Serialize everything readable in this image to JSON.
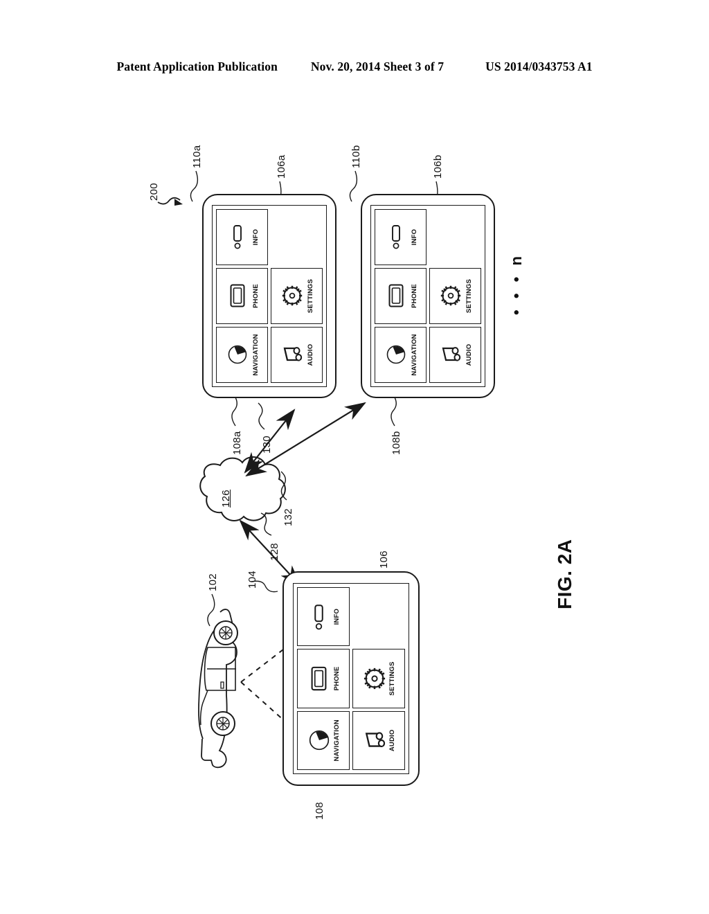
{
  "header": {
    "publication": "Patent Application Publication",
    "date_sheet": "Nov. 20, 2014  Sheet 3 of 7",
    "patent_number": "US 2014/0343753 A1"
  },
  "figure": {
    "label": "FIG. 2A",
    "system_ref": "200",
    "continuation": "• • •  n"
  },
  "tiles": {
    "navigation": "NAVIGATION",
    "phone": "PHONE",
    "info": "INFO",
    "audio": "AUDIO",
    "settings": "SETTINGS"
  },
  "icons": {
    "navigation": "compass-icon",
    "phone": "phone-icon",
    "info": "info-icon",
    "audio": "music-note-icon",
    "settings": "gear-icon",
    "vehicle": "car-icon",
    "network": "cloud-icon"
  },
  "refs": {
    "vehicle": "102",
    "vehicle_unit": "104",
    "display_main": "106",
    "ui_main": "108",
    "device_a_display": "106a",
    "device_a_ui": "108a",
    "device_a_body": "110a",
    "device_b_display": "106b",
    "device_b_ui": "108b",
    "device_b_body": "110b",
    "cloud": "126",
    "link_vehicle_cloud": "128",
    "link_cloud_device_a": "130",
    "link_cloud_device_b": "132"
  }
}
